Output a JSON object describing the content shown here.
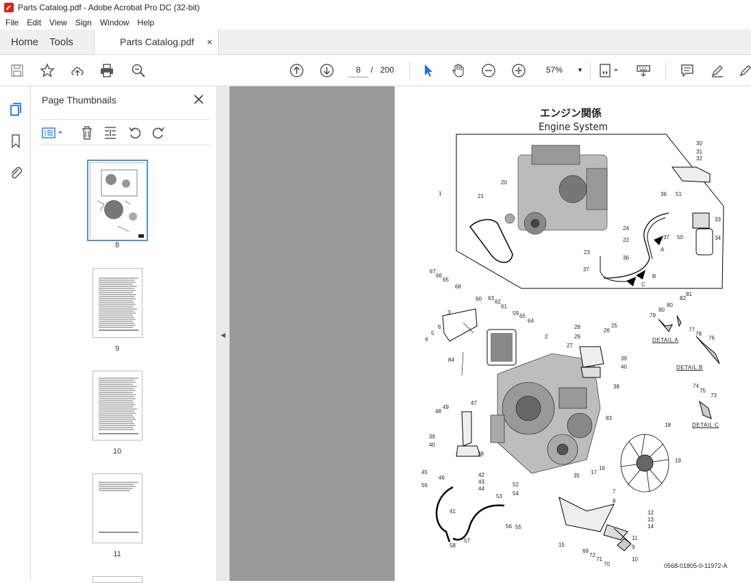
{
  "window": {
    "title": "Parts Catalog.pdf - Adobe Acrobat Pro DC (32-bit)"
  },
  "menu": [
    "File",
    "Edit",
    "View",
    "Sign",
    "Window",
    "Help"
  ],
  "tabs": {
    "home": "Home",
    "tools": "Tools",
    "document": "Parts Catalog.pdf",
    "close": "×"
  },
  "toolbar": {
    "current_page": "8",
    "separator": "/",
    "total_pages": "200",
    "zoom": "57%"
  },
  "panel": {
    "title": "Page Thumbnails",
    "thumbnails": [
      {
        "label": "8",
        "selected": true
      },
      {
        "label": "9",
        "selected": false
      },
      {
        "label": "10",
        "selected": false
      },
      {
        "label": "11",
        "selected": false
      }
    ]
  },
  "document": {
    "title_jp": "エンジン関係",
    "title_en": "Engine System",
    "doc_id": "0568-01805-0-11972-A",
    "details": [
      "DETAIL A",
      "DETAIL B",
      "DETAIL C"
    ],
    "callout_A": "A",
    "callout_B": "B",
    "callout_C": "C",
    "part_numbers": [
      "1",
      "2",
      "3",
      "4",
      "5",
      "6",
      "7",
      "8",
      "9",
      "10",
      "11",
      "12",
      "13",
      "14",
      "15",
      "16",
      "17",
      "18",
      "19",
      "20",
      "21",
      "22",
      "23",
      "24",
      "25",
      "26",
      "27",
      "28",
      "29",
      "30",
      "31",
      "32",
      "33",
      "34",
      "35",
      "36",
      "37",
      "38",
      "39",
      "40",
      "41",
      "42",
      "43",
      "44",
      "45",
      "46",
      "47",
      "48",
      "49",
      "50",
      "51",
      "52",
      "53",
      "54",
      "55",
      "56",
      "57",
      "58",
      "59",
      "60",
      "61",
      "62",
      "63",
      "64",
      "65",
      "66",
      "67",
      "68",
      "69",
      "70",
      "71",
      "72",
      "73",
      "74",
      "75",
      "76",
      "77",
      "78",
      "79",
      "80",
      "81",
      "82",
      "83",
      "84"
    ]
  },
  "colors": {
    "accent": "#1a73e8",
    "canvas": "#9a9a9a",
    "selection": "#4a90d9"
  }
}
